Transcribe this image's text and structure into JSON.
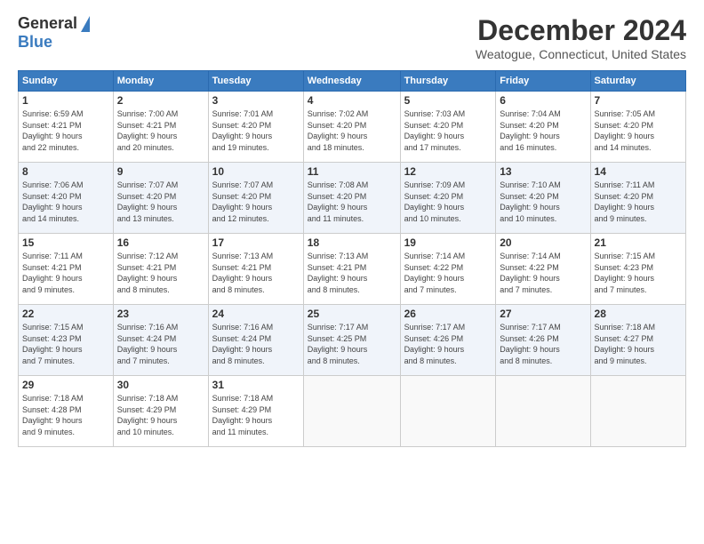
{
  "header": {
    "logo_general": "General",
    "logo_blue": "Blue",
    "main_title": "December 2024",
    "subtitle": "Weatogue, Connecticut, United States"
  },
  "calendar": {
    "days_of_week": [
      "Sunday",
      "Monday",
      "Tuesday",
      "Wednesday",
      "Thursday",
      "Friday",
      "Saturday"
    ],
    "weeks": [
      [
        {
          "day": "",
          "info": ""
        },
        {
          "day": "2",
          "info": "Sunrise: 7:00 AM\nSunset: 4:21 PM\nDaylight: 9 hours\nand 20 minutes."
        },
        {
          "day": "3",
          "info": "Sunrise: 7:01 AM\nSunset: 4:20 PM\nDaylight: 9 hours\nand 19 minutes."
        },
        {
          "day": "4",
          "info": "Sunrise: 7:02 AM\nSunset: 4:20 PM\nDaylight: 9 hours\nand 18 minutes."
        },
        {
          "day": "5",
          "info": "Sunrise: 7:03 AM\nSunset: 4:20 PM\nDaylight: 9 hours\nand 17 minutes."
        },
        {
          "day": "6",
          "info": "Sunrise: 7:04 AM\nSunset: 4:20 PM\nDaylight: 9 hours\nand 16 minutes."
        },
        {
          "day": "7",
          "info": "Sunrise: 7:05 AM\nSunset: 4:20 PM\nDaylight: 9 hours\nand 14 minutes."
        }
      ],
      [
        {
          "day": "8",
          "info": "Sunrise: 7:06 AM\nSunset: 4:20 PM\nDaylight: 9 hours\nand 14 minutes."
        },
        {
          "day": "9",
          "info": "Sunrise: 7:07 AM\nSunset: 4:20 PM\nDaylight: 9 hours\nand 13 minutes."
        },
        {
          "day": "10",
          "info": "Sunrise: 7:07 AM\nSunset: 4:20 PM\nDaylight: 9 hours\nand 12 minutes."
        },
        {
          "day": "11",
          "info": "Sunrise: 7:08 AM\nSunset: 4:20 PM\nDaylight: 9 hours\nand 11 minutes."
        },
        {
          "day": "12",
          "info": "Sunrise: 7:09 AM\nSunset: 4:20 PM\nDaylight: 9 hours\nand 10 minutes."
        },
        {
          "day": "13",
          "info": "Sunrise: 7:10 AM\nSunset: 4:20 PM\nDaylight: 9 hours\nand 10 minutes."
        },
        {
          "day": "14",
          "info": "Sunrise: 7:11 AM\nSunset: 4:20 PM\nDaylight: 9 hours\nand 9 minutes."
        }
      ],
      [
        {
          "day": "15",
          "info": "Sunrise: 7:11 AM\nSunset: 4:21 PM\nDaylight: 9 hours\nand 9 minutes."
        },
        {
          "day": "16",
          "info": "Sunrise: 7:12 AM\nSunset: 4:21 PM\nDaylight: 9 hours\nand 8 minutes."
        },
        {
          "day": "17",
          "info": "Sunrise: 7:13 AM\nSunset: 4:21 PM\nDaylight: 9 hours\nand 8 minutes."
        },
        {
          "day": "18",
          "info": "Sunrise: 7:13 AM\nSunset: 4:21 PM\nDaylight: 9 hours\nand 8 minutes."
        },
        {
          "day": "19",
          "info": "Sunrise: 7:14 AM\nSunset: 4:22 PM\nDaylight: 9 hours\nand 7 minutes."
        },
        {
          "day": "20",
          "info": "Sunrise: 7:14 AM\nSunset: 4:22 PM\nDaylight: 9 hours\nand 7 minutes."
        },
        {
          "day": "21",
          "info": "Sunrise: 7:15 AM\nSunset: 4:23 PM\nDaylight: 9 hours\nand 7 minutes."
        }
      ],
      [
        {
          "day": "22",
          "info": "Sunrise: 7:15 AM\nSunset: 4:23 PM\nDaylight: 9 hours\nand 7 minutes."
        },
        {
          "day": "23",
          "info": "Sunrise: 7:16 AM\nSunset: 4:24 PM\nDaylight: 9 hours\nand 7 minutes."
        },
        {
          "day": "24",
          "info": "Sunrise: 7:16 AM\nSunset: 4:24 PM\nDaylight: 9 hours\nand 8 minutes."
        },
        {
          "day": "25",
          "info": "Sunrise: 7:17 AM\nSunset: 4:25 PM\nDaylight: 9 hours\nand 8 minutes."
        },
        {
          "day": "26",
          "info": "Sunrise: 7:17 AM\nSunset: 4:26 PM\nDaylight: 9 hours\nand 8 minutes."
        },
        {
          "day": "27",
          "info": "Sunrise: 7:17 AM\nSunset: 4:26 PM\nDaylight: 9 hours\nand 8 minutes."
        },
        {
          "day": "28",
          "info": "Sunrise: 7:18 AM\nSunset: 4:27 PM\nDaylight: 9 hours\nand 9 minutes."
        }
      ],
      [
        {
          "day": "29",
          "info": "Sunrise: 7:18 AM\nSunset: 4:28 PM\nDaylight: 9 hours\nand 9 minutes."
        },
        {
          "day": "30",
          "info": "Sunrise: 7:18 AM\nSunset: 4:29 PM\nDaylight: 9 hours\nand 10 minutes."
        },
        {
          "day": "31",
          "info": "Sunrise: 7:18 AM\nSunset: 4:29 PM\nDaylight: 9 hours\nand 11 minutes."
        },
        {
          "day": "",
          "info": ""
        },
        {
          "day": "",
          "info": ""
        },
        {
          "day": "",
          "info": ""
        },
        {
          "day": "",
          "info": ""
        }
      ]
    ],
    "first_day": {
      "day": "1",
      "info": "Sunrise: 6:59 AM\nSunset: 4:21 PM\nDaylight: 9 hours\nand 22 minutes."
    }
  }
}
